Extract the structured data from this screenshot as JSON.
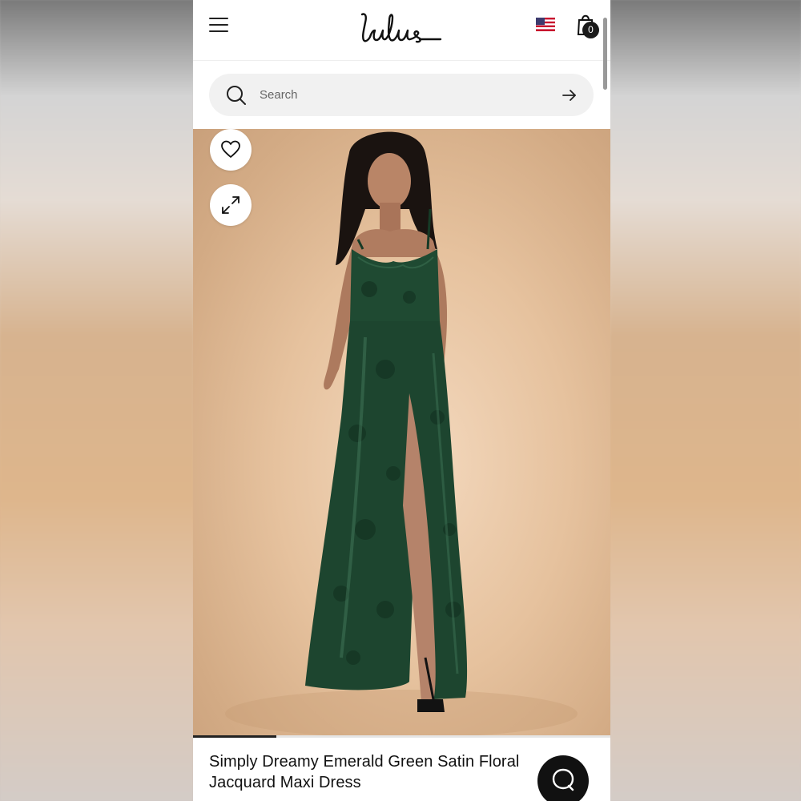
{
  "header": {
    "logo_text": "Lulus",
    "cart_count": "0"
  },
  "search": {
    "placeholder": "Search"
  },
  "gallery": {
    "progress_fraction": 0.2
  },
  "product": {
    "title": "Simply Dreamy Emerald Green Satin Floral Jacquard Maxi Dress"
  },
  "icons": [
    "menu-icon",
    "flag-icon",
    "shopping-bag-icon",
    "search-icon",
    "arrow-right-icon",
    "heart-icon",
    "expand-icon",
    "chat-icon"
  ],
  "colors": {
    "dress": "#1f4a32",
    "background": "#e6c29e",
    "text": "#111111"
  }
}
